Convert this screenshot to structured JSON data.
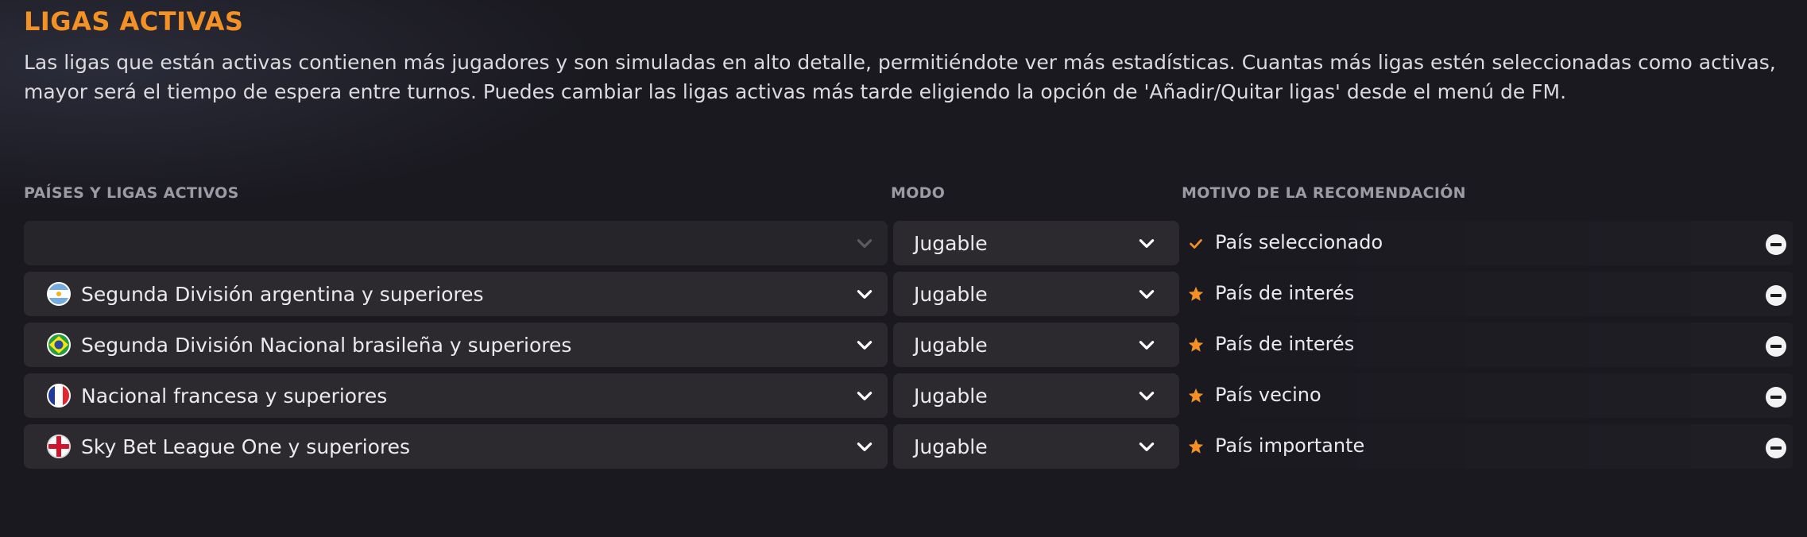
{
  "section": {
    "title": "LIGAS ACTIVAS",
    "description": "Las ligas que están activas contienen más jugadores y son simuladas en alto detalle, permitiéndote ver más estadísticas. Cuantas más ligas estén seleccionadas como activas, mayor será el tiempo de espera entre turnos. Puedes cambiar las ligas activas más tarde eligiendo la opción de 'Añadir/Quitar ligas' desde el menú de FM."
  },
  "columns": {
    "leagues": "PAÍSES Y LIGAS ACTIVOS",
    "mode": "MODO",
    "reason": "MOTIVO DE LA RECOMENDACIÓN"
  },
  "colors": {
    "accent": "#f39124",
    "row_bg": "#2c2a2f",
    "background": "#1a1920"
  },
  "rows": [
    {
      "league": "",
      "flag": "none",
      "mode": "Jugable",
      "reason_icon": "check-icon",
      "reason": "País seleccionado"
    },
    {
      "league": "Segunda División argentina y superiores",
      "flag": "argentina-flag-icon",
      "mode": "Jugable",
      "reason_icon": "star-icon",
      "reason": "País de interés"
    },
    {
      "league": "Segunda División Nacional brasileña y superiores",
      "flag": "brazil-flag-icon",
      "mode": "Jugable",
      "reason_icon": "star-icon",
      "reason": "País de interés"
    },
    {
      "league": "Nacional francesa y superiores",
      "flag": "france-flag-icon",
      "mode": "Jugable",
      "reason_icon": "star-icon",
      "reason": "País vecino"
    },
    {
      "league": "Sky Bet League One y superiores",
      "flag": "england-flag-icon",
      "mode": "Jugable",
      "reason_icon": "star-icon",
      "reason": "País importante"
    }
  ]
}
